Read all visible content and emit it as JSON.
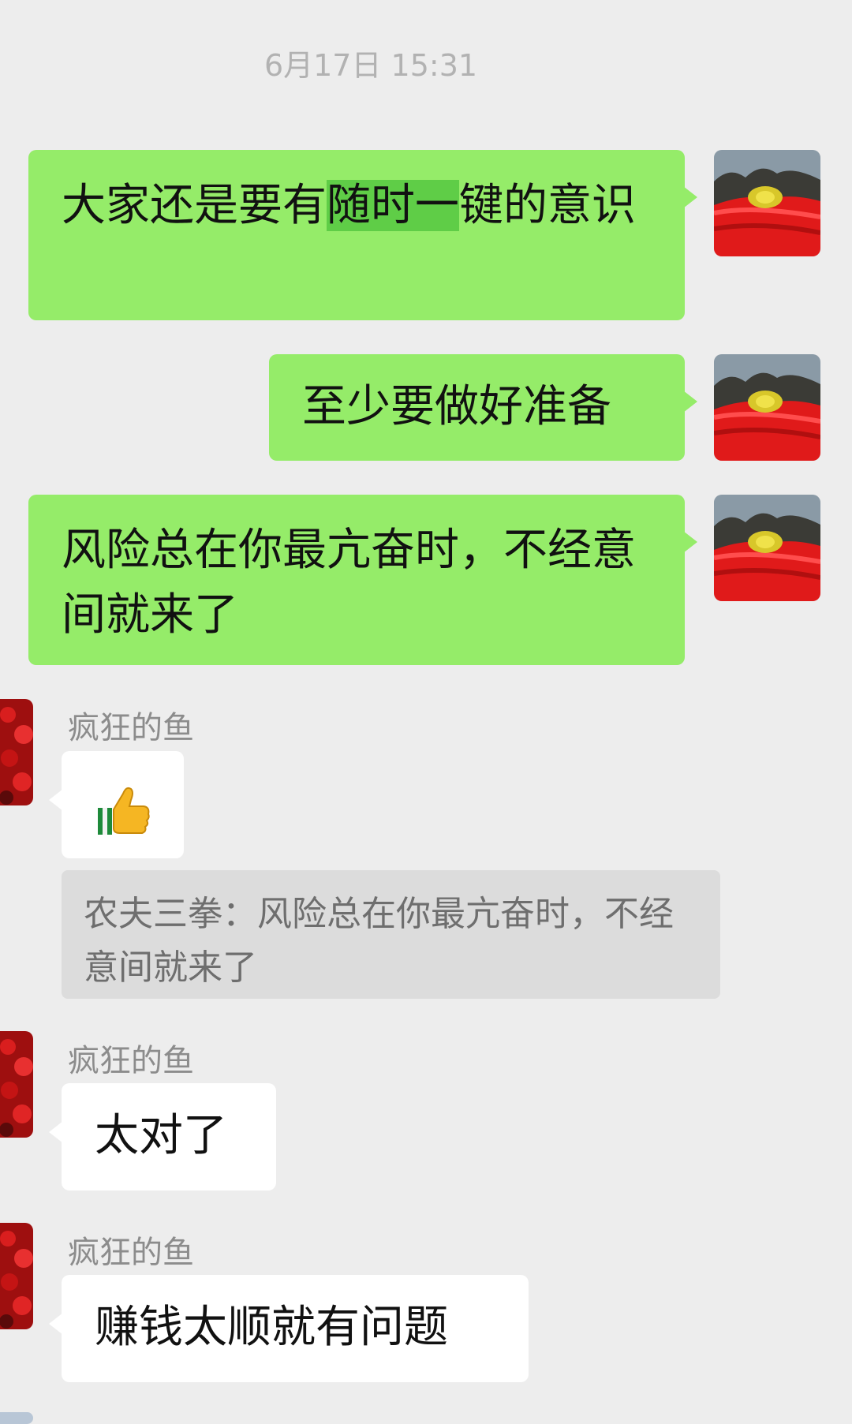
{
  "timestamp": "6月17日 15:31",
  "messages": [
    {
      "side": "me",
      "text_before": "大家还是要有",
      "text_highlight": "随时一",
      "text_after": "键的意识"
    },
    {
      "side": "me",
      "text": "至少要做好准备"
    },
    {
      "side": "me",
      "text": "风险总在你最亢奋时，不经意间就来了"
    },
    {
      "side": "them",
      "sender": "疯狂的鱼",
      "content": "thumbs-up-emoji",
      "quote": "农夫三拳：风险总在你最亢奋时，不经意间就来了"
    },
    {
      "side": "them",
      "sender": "疯狂的鱼",
      "text": "太对了"
    },
    {
      "side": "them",
      "sender": "疯狂的鱼",
      "text": "赚钱太顺就有问题"
    }
  ],
  "colors": {
    "background": "#ededed",
    "my_bubble": "#95ec69",
    "their_bubble": "#ffffff",
    "highlight": "#5fcd47",
    "quote_bg": "#dcdcdc"
  }
}
